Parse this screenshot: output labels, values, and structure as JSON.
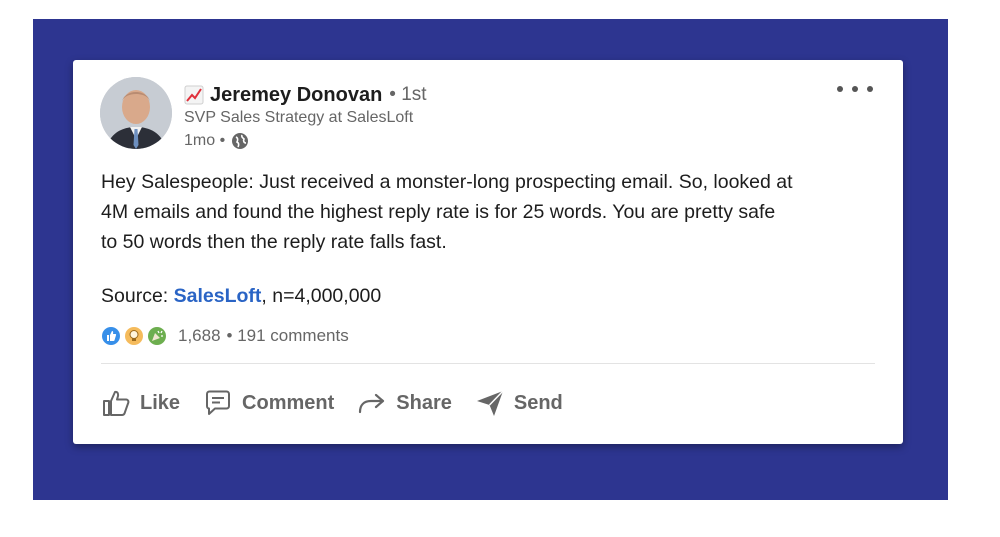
{
  "post": {
    "author_name": "Jeremey Donovan",
    "degree": "• 1st",
    "headline": "SVP Sales Strategy at SalesLoft",
    "time": "1mo •",
    "body_lines": [
      "Hey Salespeople: Just received a monster-long prospecting email. So, looked at",
      "4M emails and found the highest reply rate is for 25 words. You are pretty safe",
      "to 50 words then the reply rate falls fast."
    ],
    "source_prefix": "Source: ",
    "source_link": "SalesLoft",
    "source_suffix": ", n=4,000,000",
    "reaction_count": "1,688",
    "comments": "• 191 comments",
    "reaction_icons": [
      "like-reaction-icon",
      "insightful-reaction-icon",
      "celebrate-reaction-icon"
    ]
  },
  "actions": {
    "like": "Like",
    "comment": "Comment",
    "share": "Share",
    "send": "Send"
  },
  "colors": {
    "frame": "#2d3590",
    "link": "#2a64c5",
    "text_secondary": "#666666"
  }
}
